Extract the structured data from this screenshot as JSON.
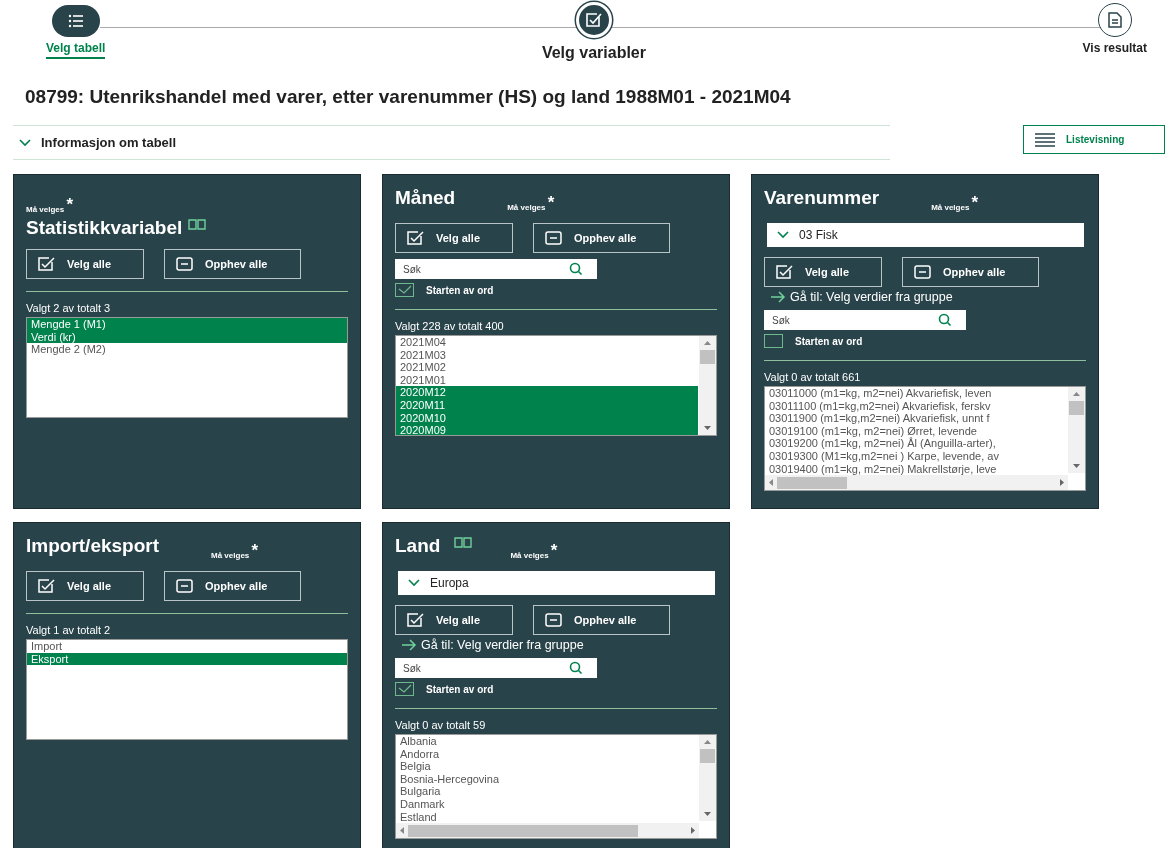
{
  "steps": [
    {
      "label": "Velg tabell",
      "completed": true,
      "selected": false
    },
    {
      "label": "Velg variabler",
      "completed": false,
      "selected": true
    },
    {
      "label": "Vis resultat",
      "completed": false,
      "selected": false
    }
  ],
  "title": "08799: Utenrikshandel med varer, etter varenummer (HS) og land 1988M01 - 2021M04",
  "info_toggle": {
    "label": "Informasjon om tabell",
    "expanded": false
  },
  "view_button": "Listevisning",
  "panels": [
    {
      "title": "Statistikkvariabel",
      "required": "Må velges",
      "required_mark": "*",
      "required_above_title": true,
      "definition_link": true,
      "select_all": "Velg alle",
      "deselect_all": "Opphev alle",
      "count": "Valgt 2 av totalt 3",
      "items": [
        {
          "label": "Mengde 1 (M1)",
          "selected": true
        },
        {
          "label": "Verdi (kr)",
          "selected": true
        },
        {
          "label": "Mengde 2 (M2)",
          "selected": false
        }
      ]
    },
    {
      "title": "Måned",
      "required": "Må velges",
      "required_mark": "*",
      "select_all": "Velg alle",
      "deselect_all": "Opphev alle",
      "search": {
        "placeholder": "Søk",
        "option": "Starten av ord",
        "checked": true
      },
      "count": "Valgt 228 av totalt 400",
      "vertical_scrollbar": true,
      "items": [
        {
          "label": "2021M04",
          "selected": false
        },
        {
          "label": "2021M03",
          "selected": false
        },
        {
          "label": "2021M02",
          "selected": false
        },
        {
          "label": "2021M01",
          "selected": false
        },
        {
          "label": "2020M12",
          "selected": true
        },
        {
          "label": "2020M11",
          "selected": true
        },
        {
          "label": "2020M10",
          "selected": true
        },
        {
          "label": "2020M09",
          "selected": true
        }
      ]
    },
    {
      "title": "Varenummer",
      "required": "Må velges",
      "required_mark": "*",
      "group": "03 Fisk",
      "select_all": "Velg alle",
      "deselect_all": "Opphev alle",
      "goto": "Gå til: Velg verdier fra gruppe",
      "search": {
        "placeholder": "Søk",
        "option": "Starten av ord",
        "checked": false
      },
      "count": "Valgt 0 av totalt 661",
      "vertical_scrollbar": true,
      "horizontal_scrollbar": true,
      "items": [
        {
          "label": "03011000 (m1=kg, m2=nei) Akvariefisk, leven",
          "selected": false
        },
        {
          "label": "03011100 (m1=kg,m2=nei) Akvariefisk, ferskv",
          "selected": false
        },
        {
          "label": "03011900 (m1=kg,m2=nei) Akvariefisk, unnt f",
          "selected": false
        },
        {
          "label": "03019100 (m1=kg, m2=nei) Ørret, levende",
          "selected": false
        },
        {
          "label": "03019200 (m1=kg, m2=nei) Ål (Anguilla-arter),",
          "selected": false
        },
        {
          "label": "03019300 (M1=kg,m2=nei ) Karpe, levende, av",
          "selected": false
        },
        {
          "label": "03019400 (m1=kg, m2=nei) Makrellstørje, leve",
          "selected": false
        }
      ]
    },
    {
      "title": "Import/eksport",
      "required": "Må velges",
      "required_mark": "*",
      "select_all": "Velg alle",
      "deselect_all": "Opphev alle",
      "count": "Valgt 1 av totalt 2",
      "items": [
        {
          "label": "Import",
          "selected": false
        },
        {
          "label": "Eksport",
          "selected": true
        }
      ]
    },
    {
      "title": "Land",
      "required": "Må velges",
      "required_mark": "*",
      "definition_link": true,
      "group": "Europa",
      "select_all": "Velg alle",
      "deselect_all": "Opphev alle",
      "goto": "Gå til: Velg verdier fra gruppe",
      "search": {
        "placeholder": "Søk",
        "option": "Starten av ord",
        "checked": true
      },
      "count": "Valgt 0 av totalt 59",
      "vertical_scrollbar": true,
      "horizontal_scrollbar": true,
      "items": [
        {
          "label": "Albania",
          "selected": false
        },
        {
          "label": "Andorra",
          "selected": false
        },
        {
          "label": "Belgia",
          "selected": false
        },
        {
          "label": "Bosnia-Hercegovina",
          "selected": false
        },
        {
          "label": "Bulgaria",
          "selected": false
        },
        {
          "label": "Danmark",
          "selected": false
        },
        {
          "label": "Estland",
          "selected": false
        }
      ]
    }
  ]
}
